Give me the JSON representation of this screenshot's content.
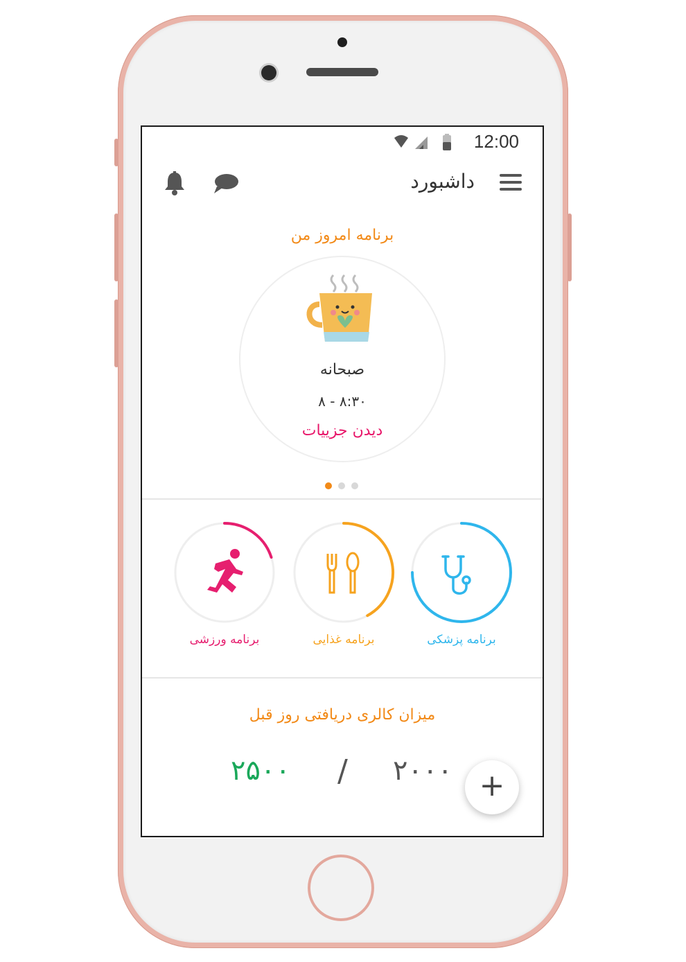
{
  "status_bar": {
    "time": "12:00"
  },
  "app_bar": {
    "title": "داشبورد"
  },
  "today": {
    "title": "برنامه امروز من",
    "meal_name": "صبحانه",
    "meal_time": "۸:۳۰ - ۸",
    "details_link": "دیدن جزییات",
    "pager": {
      "count": 3,
      "active_index": 0
    }
  },
  "programs": [
    {
      "label": "برنامه پزشکی",
      "icon": "stethoscope-icon",
      "color": "#2fb6ec",
      "progress": 0.75
    },
    {
      "label": "برنامه غذایی",
      "icon": "fork-spoon-icon",
      "color": "#f6a31f",
      "progress": 0.42
    },
    {
      "label": "برنامه ورزشی",
      "icon": "runner-icon",
      "color": "#e61f6f",
      "progress": 0.2
    }
  ],
  "calories": {
    "title": "میزان کالری دریافتی روز قبل",
    "current": "۲۰۰۰",
    "separator": "/",
    "target": "۲۵۰۰",
    "add_label": "+"
  },
  "colors": {
    "accent_orange": "#f28a18",
    "link_pink": "#e8176a",
    "success_green": "#1aa85a"
  }
}
